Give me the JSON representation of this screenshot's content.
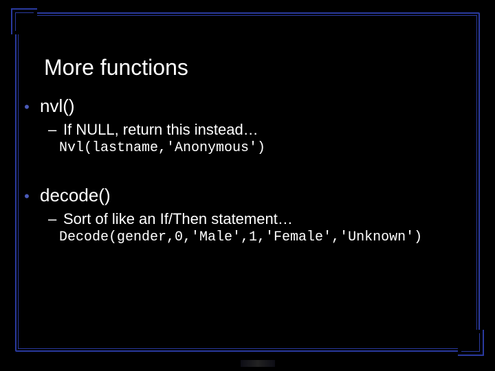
{
  "title": "More functions",
  "sections": [
    {
      "bullet": "nvl()",
      "sub": "If NULL, return this instead…",
      "code": "Nvl(lastname,'Anonymous')"
    },
    {
      "bullet": "decode()",
      "sub": "Sort of like an If/Then statement…",
      "code": "Decode(gender,0,'Male',1,'Female','Unknown')"
    }
  ]
}
